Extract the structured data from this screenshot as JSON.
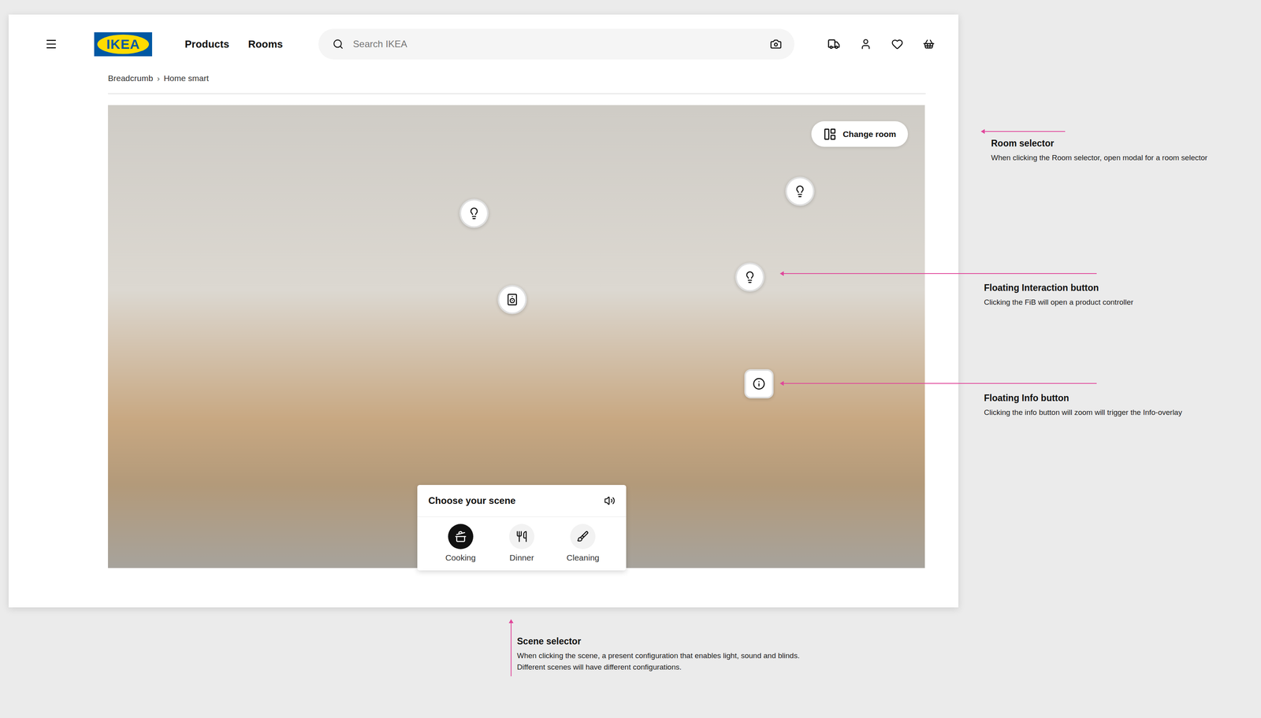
{
  "header": {
    "logo": "IKEA",
    "nav": [
      {
        "label": "Products"
      },
      {
        "label": "Rooms"
      }
    ],
    "search": {
      "placeholder": "Search IKEA"
    }
  },
  "breadcrumb": {
    "separator": "›",
    "items": [
      {
        "label": "Breadcrumb"
      },
      {
        "label": "Home smart"
      }
    ]
  },
  "room_view": {
    "change_room": "Change room",
    "hotspots": [
      {
        "kind": "light"
      },
      {
        "kind": "light"
      },
      {
        "kind": "light"
      },
      {
        "kind": "speaker"
      },
      {
        "kind": "info"
      }
    ]
  },
  "scene_selector": {
    "title": "Choose your scene",
    "scenes": [
      {
        "label": "Cooking",
        "selected": true
      },
      {
        "label": "Dinner",
        "selected": false
      },
      {
        "label": "Cleaning",
        "selected": false
      }
    ]
  },
  "annotations": [
    {
      "title": "Room selector",
      "lines": [
        "When clicking the Room selector, open modal for a room selector"
      ]
    },
    {
      "title": "Floating Interaction button",
      "lines": [
        "Clicking the FiB will open a product controller"
      ]
    },
    {
      "title": "Floating Info button",
      "lines": [
        "Clicking the info button will zoom will trigger the Info-overlay"
      ]
    },
    {
      "title": "Scene selector",
      "lines": [
        "When clicking the scene, a present configuration that enables light, sound and blinds.",
        "Different scenes will have different configurations."
      ]
    }
  ]
}
